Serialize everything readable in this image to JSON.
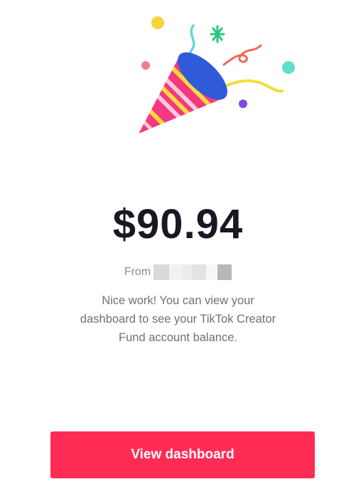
{
  "payout": {
    "amount": "$90.94",
    "from_label": "From",
    "from_value_redacted": true,
    "message": "Nice work! You can view your dashboard to see your TikTok Creator Fund account balance."
  },
  "actions": {
    "view_dashboard_label": "View dashboard"
  },
  "illustration": {
    "icon": "party-popper-icon"
  },
  "colors": {
    "accent": "#fe2c55",
    "amount_text": "#161823",
    "secondary_text": "#6f7078"
  }
}
